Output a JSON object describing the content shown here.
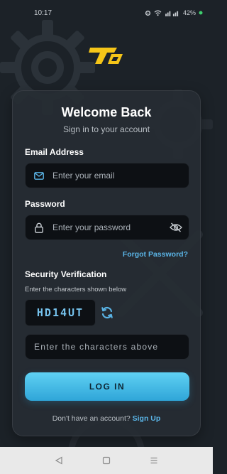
{
  "status_bar": {
    "time": "10:17",
    "battery": "42%",
    "icons": [
      "settings-status-icon",
      "wifi-icon",
      "signal-icon",
      "battery-icon"
    ]
  },
  "app": {
    "logo_icon": "brand-logo-icon",
    "brand_color": "#f5c518"
  },
  "login": {
    "title": "Welcome Back",
    "subtitle": "Sign in to your account",
    "email": {
      "label": "Email Address",
      "placeholder": "Enter your email",
      "value": "",
      "icon": "mail-icon"
    },
    "password": {
      "label": "Password",
      "placeholder": "Enter your password",
      "value": "",
      "icon": "lock-icon",
      "toggle_icon": "eye-off-icon"
    },
    "forgot_password": "Forgot Password?",
    "captcha": {
      "label": "Security Verification",
      "hint": "Enter the characters shown below",
      "code": "HD14UT",
      "refresh_icon": "refresh-icon",
      "placeholder": "Enter the characters above",
      "value": ""
    },
    "login_button": "LOG IN",
    "signup_prompt": "Don't have an account?",
    "signup_link": "Sign Up",
    "accent_color": "#5ab4e6"
  },
  "nav_bar": {
    "icons": [
      "back-triangle-icon",
      "home-square-icon",
      "recents-menu-icon"
    ]
  }
}
